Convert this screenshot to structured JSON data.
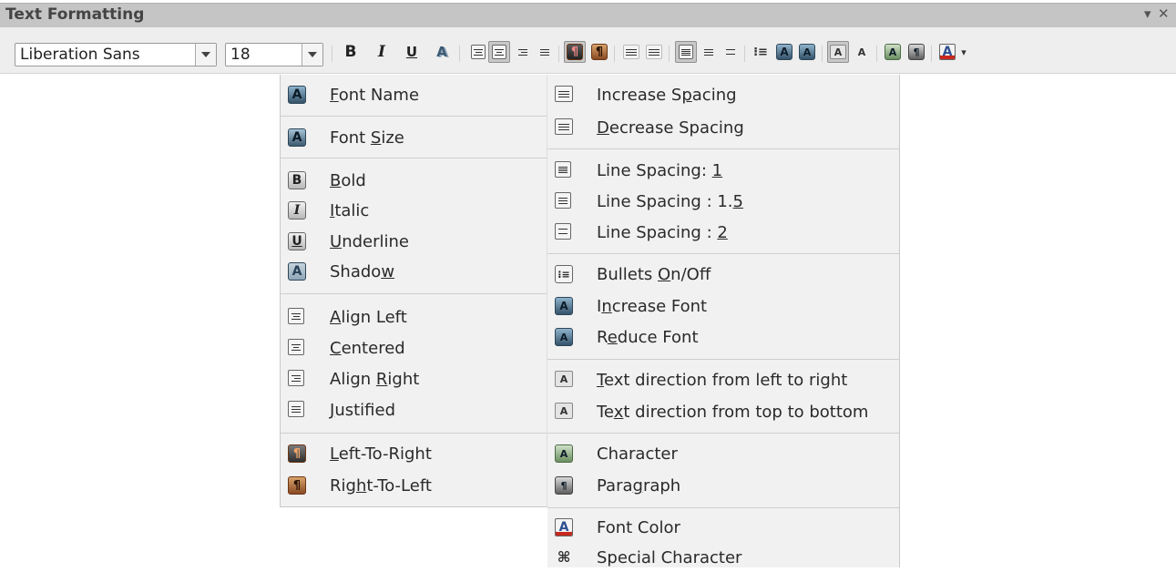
{
  "window": {
    "title": "Text Formatting",
    "menu_glyph": "▾",
    "close_glyph": "✕"
  },
  "toolbar": {
    "font_name": "Liberation Sans",
    "font_size": "18",
    "bold": "B",
    "italic": "I",
    "underline": "U",
    "shadow": "A",
    "char_glyph": "A",
    "dropdown_glyph": "▾"
  },
  "menu": {
    "col1": [
      {
        "pre": "",
        "key": "F",
        "post": "ont Name"
      },
      {
        "pre": "Font ",
        "key": "S",
        "post": "ize"
      },
      {
        "pre": "",
        "key": "B",
        "post": "old"
      },
      {
        "pre": "",
        "key": "I",
        "post": "talic"
      },
      {
        "pre": "",
        "key": "U",
        "post": "nderline"
      },
      {
        "pre": "Shado",
        "key": "w",
        "post": ""
      },
      {
        "pre": "",
        "key": "A",
        "post": "lign Left"
      },
      {
        "pre": "",
        "key": "C",
        "post": "entered"
      },
      {
        "pre": "Align ",
        "key": "R",
        "post": "ight"
      },
      {
        "pre": "",
        "key": "J",
        "post": "ustified"
      },
      {
        "pre": "",
        "key": "L",
        "post": "eft-To-Right"
      },
      {
        "pre": "Rig",
        "key": "h",
        "post": "t-To-Left"
      }
    ],
    "col2": [
      {
        "pre": "Increase S",
        "key": "p",
        "post": "acing"
      },
      {
        "pre": "",
        "key": "D",
        "post": "ecrease Spacing"
      },
      {
        "pre": "Line Spacing: ",
        "key": "1",
        "post": ""
      },
      {
        "pre": "Line Spacing : 1.",
        "key": "5",
        "post": ""
      },
      {
        "pre": "Line Spacing : ",
        "key": "2",
        "post": ""
      },
      {
        "pre": "Bullets ",
        "key": "O",
        "post": "n/Off"
      },
      {
        "pre": "I",
        "key": "n",
        "post": "crease Font"
      },
      {
        "pre": "R",
        "key": "e",
        "post": "duce Font"
      },
      {
        "pre": "",
        "key": "T",
        "post": "ext direction from left to right"
      },
      {
        "pre": "Te",
        "key": "x",
        "post": "t direction from top to bottom"
      },
      {
        "pre": "Character",
        "key": "",
        "post": ""
      },
      {
        "pre": "Para",
        "key": "g",
        "post": "raph"
      },
      {
        "pre": "Font Color",
        "key": "",
        "post": ""
      },
      {
        "pre": "Special Character",
        "key": "",
        "post": ""
      }
    ]
  },
  "icon_glyphs": {
    "bold": "B",
    "italic": "I",
    "underline": "U",
    "letter_a": "A",
    "ltr": "¶",
    "rtl": "¶",
    "bullets": "⁝≡",
    "special": "⌘"
  },
  "colors": {
    "toolbar_bg": "#eeeeee",
    "menu_bg": "#f1f1f1",
    "title_bg": "#c5c5c5",
    "active_button": "#c8c8c8",
    "font_color_bar": "#c8281e"
  }
}
